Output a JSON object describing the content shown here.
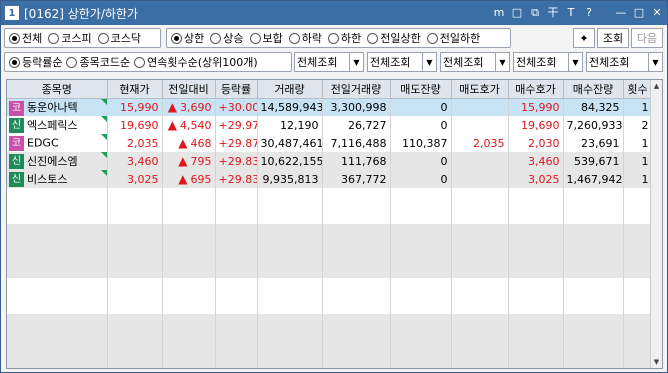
{
  "window": {
    "num": "1",
    "title": "[0162] 상한가/하한가"
  },
  "titlebar_icons": {
    "m": "m",
    "restore": "□",
    "copy": "⧉",
    "pin": "干",
    "text": "T",
    "help": "?",
    "min": "—",
    "max": "□",
    "close": "✕"
  },
  "market_radios": [
    "전체",
    "코스피",
    "코스닥"
  ],
  "type_radios": [
    "상한",
    "상승",
    "보합",
    "하락",
    "하한",
    "전일상한",
    "전일하한"
  ],
  "buttons": {
    "icon_btn": "✦",
    "search": "조회",
    "next": "다음"
  },
  "sort_radios": [
    "등락률순",
    "종목코드순",
    "연속횟수순(상위100개)"
  ],
  "filters": [
    "전체조회",
    "전체조회",
    "전체조회",
    "전체조회",
    "전체조회"
  ],
  "table": {
    "headers": [
      "종목명",
      "현재가",
      "전일대비",
      "등락률",
      "거래량",
      "전일거래량",
      "매도잔량",
      "매도호가",
      "매수호가",
      "매수잔량",
      "횟수"
    ],
    "rows": [
      {
        "badge": "코",
        "name": "동운아나텍",
        "price": "15,990",
        "change": "3,690",
        "rate": "+30.00",
        "volume": "14,589,943",
        "prev_volume": "3,300,998",
        "ask_qty": "0",
        "ask_price": "",
        "bid_price": "15,990",
        "bid_qty": "84,325",
        "count": "1"
      },
      {
        "badge": "신",
        "name": "엑스페릭스",
        "price": "19,690",
        "change": "4,540",
        "rate": "+29.97",
        "volume": "12,190",
        "prev_volume": "26,727",
        "ask_qty": "0",
        "ask_price": "",
        "bid_price": "19,690",
        "bid_qty": "7,260,933",
        "count": "2"
      },
      {
        "badge": "코",
        "name": "EDGC",
        "price": "2,035",
        "change": "468",
        "rate": "+29.87",
        "volume": "30,487,461",
        "prev_volume": "7,116,488",
        "ask_qty": "110,387",
        "ask_price": "2,035",
        "bid_price": "2,030",
        "bid_qty": "23,691",
        "count": "1"
      },
      {
        "badge": "신",
        "name": "신진에스엠",
        "price": "3,460",
        "change": "795",
        "rate": "+29.83",
        "volume": "10,622,155",
        "prev_volume": "111,768",
        "ask_qty": "0",
        "ask_price": "",
        "bid_price": "3,460",
        "bid_qty": "539,671",
        "count": "1"
      },
      {
        "badge": "신",
        "name": "비스토스",
        "price": "3,025",
        "change": "695",
        "rate": "+29.83",
        "volume": "9,935,813",
        "prev_volume": "367,772",
        "ask_qty": "0",
        "ask_price": "",
        "bid_price": "3,025",
        "bid_qty": "1,467,942",
        "count": "1"
      }
    ]
  },
  "colors": {
    "titlebar": "#3a6ea5",
    "up": "#e0161c",
    "selected_row": "#c8e4f4",
    "kosdaq_badge": "#c94fa8",
    "credit_badge": "#1f8a5a"
  }
}
